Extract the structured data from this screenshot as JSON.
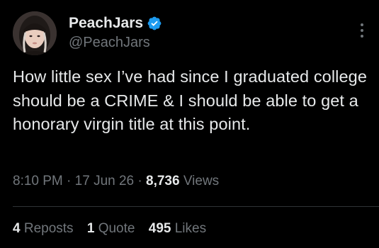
{
  "author": {
    "display_name": "PeachJars",
    "handle": "@PeachJars",
    "verified": true,
    "avatar_icon": "profile-photo"
  },
  "tweet": {
    "text": "How little sex I’ve had since I graduated college should be a CRIME & I should be able to get a honorary virgin title at this point.",
    "time": "8:10 PM",
    "date": "17 Jun 26",
    "separator": "·",
    "views_count": "8,736",
    "views_label": "Views"
  },
  "stats": {
    "reposts_count": "4",
    "reposts_label": "Reposts",
    "quotes_count": "1",
    "quotes_label": "Quote",
    "likes_count": "495",
    "likes_label": "Likes"
  },
  "icons": {
    "verified": "verified-badge-icon",
    "more": "more-options-icon"
  },
  "colors": {
    "background": "#000000",
    "primary_text": "#e7e9ea",
    "secondary_text": "#71767b",
    "verified_blue": "#1d9bf0",
    "divider": "#2f3336"
  }
}
